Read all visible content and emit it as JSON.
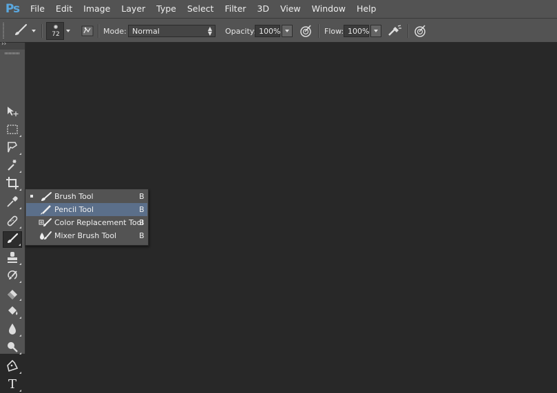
{
  "app": {
    "logo": "Ps"
  },
  "menu": [
    "File",
    "Edit",
    "Image",
    "Layer",
    "Type",
    "Select",
    "Filter",
    "3D",
    "View",
    "Window",
    "Help"
  ],
  "options_bar": {
    "brush_size": "72",
    "mode_label": "Mode:",
    "mode_value": "Normal",
    "opacity_label": "Opacity:",
    "opacity_value": "100%",
    "flow_label": "Flow:",
    "flow_value": "100%"
  },
  "toolbox": {
    "tools": [
      "move-icon",
      "marquee-icon",
      "lasso-icon",
      "magic-wand-icon",
      "crop-icon",
      "eyedropper-icon",
      "healing-brush-icon",
      "brush-icon",
      "clone-stamp-icon",
      "history-brush-icon",
      "eraser-icon",
      "paint-bucket-icon",
      "blur-icon",
      "dodge-icon",
      "pen-icon",
      "type-icon"
    ],
    "active_tool": "brush-icon"
  },
  "flyout": {
    "items": [
      {
        "label": "Brush Tool",
        "shortcut": "B",
        "icon": "brush-icon",
        "selected": true,
        "highlighted": false
      },
      {
        "label": "Pencil Tool",
        "shortcut": "B",
        "icon": "pencil-icon",
        "selected": false,
        "highlighted": true
      },
      {
        "label": "Color Replacement Tool",
        "shortcut": "B",
        "icon": "color-replacement-icon",
        "selected": false,
        "highlighted": false
      },
      {
        "label": "Mixer Brush Tool",
        "shortcut": "B",
        "icon": "mixer-brush-icon",
        "selected": false,
        "highlighted": false
      }
    ]
  },
  "colors": {
    "canvas": "#282828",
    "chrome": "#535353",
    "highlight": "#5b6f8a",
    "logo": "#5aa8e0"
  }
}
